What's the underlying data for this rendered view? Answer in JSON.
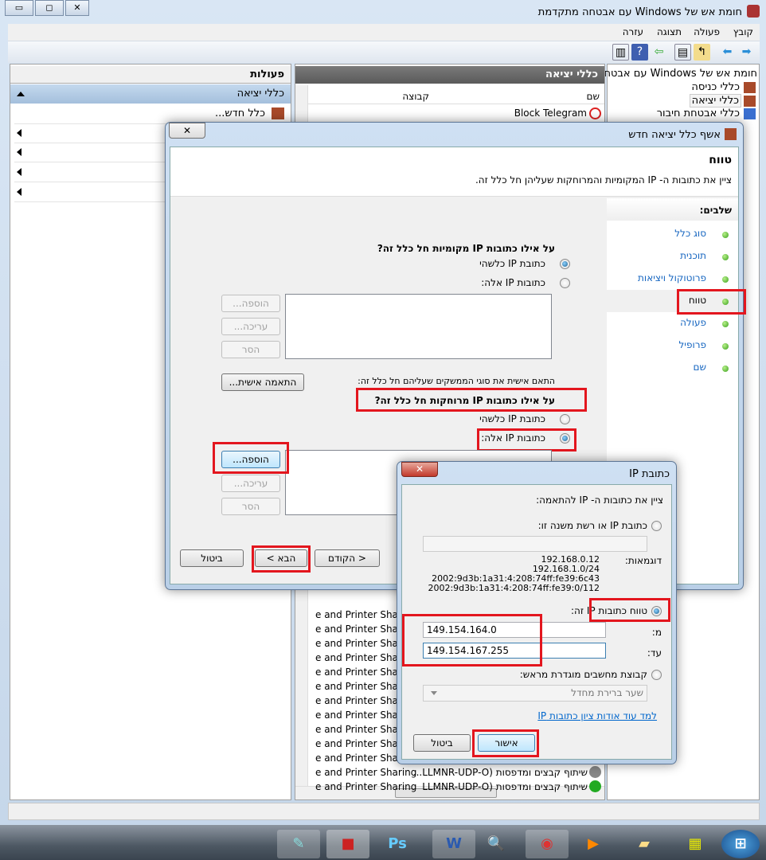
{
  "window": {
    "title": "חומת אש של Windows עם אבטחה מתקדמת",
    "min": "▭",
    "max": "◻",
    "close": "✕"
  },
  "menu": [
    "קובץ",
    "פעולה",
    "תצוגה",
    "עזרה"
  ],
  "tree": {
    "root": "חומת אש של Windows עם אבטחה",
    "items": [
      "כללי כניסה",
      "כללי יציאה",
      "כללי אבטחת חיבור"
    ]
  },
  "center": {
    "header": "כללי יציאה",
    "col_name": "שם",
    "col_group": "קבוצה",
    "first_row": "Block Telegram",
    "row_partial": "e and Printer Sharing",
    "last_rows": [
      "שיתוף קבצים ומדפסות (LLMNR-UDP-O...",
      "שיתוף קבצים ומדפסות (LLMNR-UDP-O"
    ]
  },
  "actions": {
    "header": "פעולות",
    "section": "כללי יציאה",
    "new_rule": "כלל חדש..."
  },
  "wizard": {
    "title": "אשף כלל יציאה חדש",
    "page_title": "טווח",
    "page_desc": "ציין את כתובות ה- IP המקומיות והמרוחקות שעליהן חל כלל זה.",
    "steps_header": "שלבים:",
    "steps": [
      "סוג כלל",
      "תוכנית",
      "פרוטוקול ויציאות",
      "טווח",
      "פעולה",
      "פרופיל",
      "שם"
    ],
    "local_q": "על אילו כתובות IP מקומיות חל כלל זה?",
    "any_ip": "כתובת IP כלשהי",
    "these_ip": "כתובות IP אלה:",
    "add": "הוספה...",
    "edit": "עריכה...",
    "remove": "הסר",
    "customize_text": "התאם אישית את סוגי הממשקים שעליהם חל כלל זה:",
    "customize_btn": "התאמה אישית...",
    "remote_q": "על אילו כתובות IP מרוחקות חל כלל זה?",
    "back": "< הקודם",
    "next": "הבא >",
    "cancel": "ביטול"
  },
  "ip_dialog": {
    "title": "כתובת IP",
    "prompt": "ציין את כתובות ה- IP להתאמה:",
    "opt_single": "כתובת IP או רשת משנה זו:",
    "single_value": "",
    "examples_label": "דוגמאות:",
    "examples": [
      "192.168.0.12",
      "192.168.1.0/24",
      "2002:9d3b:1a31:4:208:74ff:fe39:6c43",
      "2002:9d3b:1a31:4:208:74ff:fe39:0/112"
    ],
    "opt_range": "טווח כתובות IP זה:",
    "from_label": "מ:",
    "from_value": "149.154.164.0",
    "to_label": "עד:",
    "to_value": "149.154.167.255",
    "opt_predefined": "קבוצת מחשבים מוגדרת מראש:",
    "predefined_value": "שער ברירת מחדל",
    "learn_more": "למד עוד אודות ציון כתובות IP",
    "ok": "אישור",
    "cancel": "ביטול"
  },
  "taskbar": [
    "notepad",
    "toolbox",
    "photoshop",
    "word",
    "search-file",
    "chrome",
    "media-player",
    "explorer",
    "film-app",
    "start"
  ]
}
